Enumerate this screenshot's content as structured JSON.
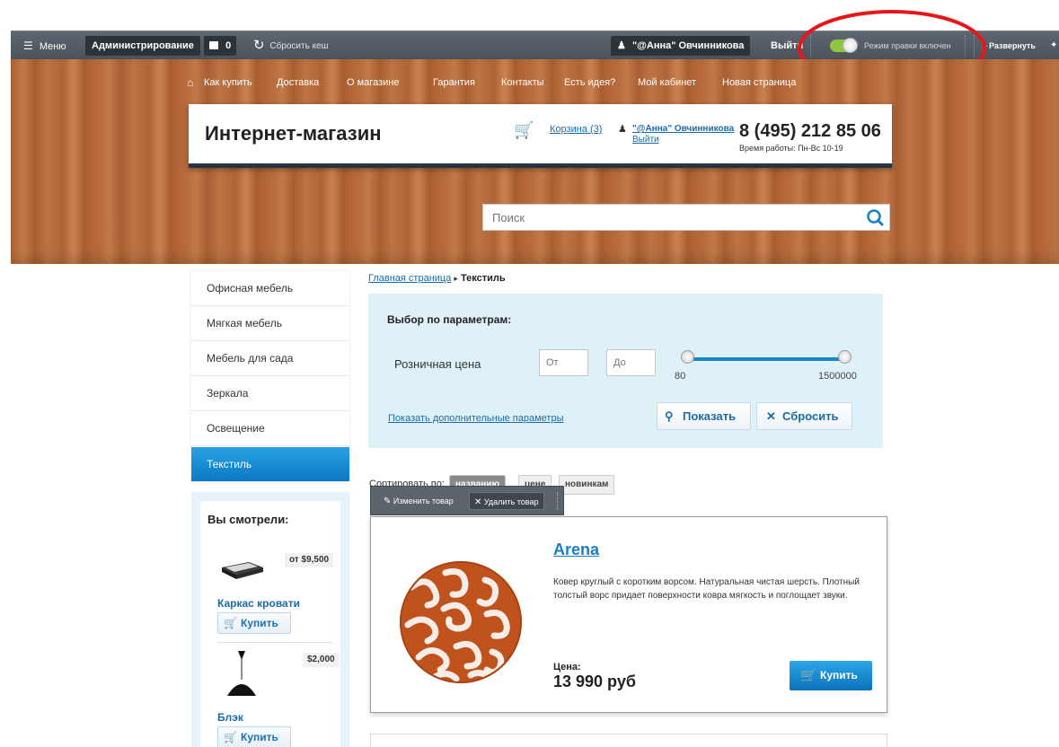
{
  "admin_bar": {
    "menu_label": "Меню",
    "admin_label": "Администрирование",
    "notifications_count": "0",
    "clear_cache_label": "Сбросить кеш",
    "user_label": "\"@Анна\" Овчинникова",
    "logout_label": "Выйти",
    "edit_mode_label": "Режим правки включен",
    "edit_mode_on": true,
    "expand_label": "Развернуть"
  },
  "top_nav": {
    "items": [
      "Как купить",
      "Доставка",
      "О магазине",
      "Гарантия",
      "Контакты",
      "Есть идея?",
      "Мой кабинет",
      "Новая страница"
    ]
  },
  "store_header": {
    "title": "Интернет-магазин",
    "cart_label": "Корзина (3)",
    "user_name": "\"@Анна\" Овчинникова",
    "logout_label": "Выйти",
    "phone": "8 (495) 212 85 06",
    "hours": "Время работы: Пн-Вс 10-19"
  },
  "search": {
    "placeholder": "Поиск"
  },
  "sidebar": {
    "categories": [
      "Офисная мебель",
      "Мягкая мебель",
      "Мебель для сада",
      "Зеркала",
      "Освещение",
      "Текстиль"
    ],
    "active_index": 5
  },
  "viewed": {
    "title": "Вы смотрели:",
    "items": [
      {
        "name": "Каркас кровати",
        "price": "от $9,500",
        "buy_label": "Купить"
      },
      {
        "name": "Блэк",
        "price": "$2,000",
        "buy_label": "Купить"
      }
    ]
  },
  "breadcrumb": {
    "home": "Главная страница",
    "separator": "▸",
    "current": "Текстиль"
  },
  "filter": {
    "title": "Выбор по параметрам:",
    "price_label": "Розничная цена",
    "from_placeholder": "От",
    "to_placeholder": "До",
    "min_value": "80",
    "max_value": "1500000",
    "more_link": "Показать дополнительные параметры",
    "show_label": "Показать",
    "reset_label": "Сбросить"
  },
  "sort": {
    "label": "Сортировать по:",
    "options": [
      "названию",
      "цене",
      "новинкам"
    ]
  },
  "edit_bar": {
    "edit_label": "Изменить товар",
    "delete_label": "Удалить товар"
  },
  "product": {
    "name": "Arena",
    "description": "Ковер круглый с коротким ворсом. Натуральная чистая шерсть. Плотный толстый ворс придает поверхности ковра мягкость и поглощает звуки.",
    "price_label": "Цена:",
    "price": "13 990 руб",
    "buy_label": "Купить"
  },
  "colors": {
    "accent_blue": "#0b79c4",
    "admin_bar": "#4f575f",
    "toggle_on": "#8dc63f",
    "annotation_red": "#e8161b",
    "filter_bg": "#dff1f8",
    "rug_orange": "#c0521d"
  }
}
